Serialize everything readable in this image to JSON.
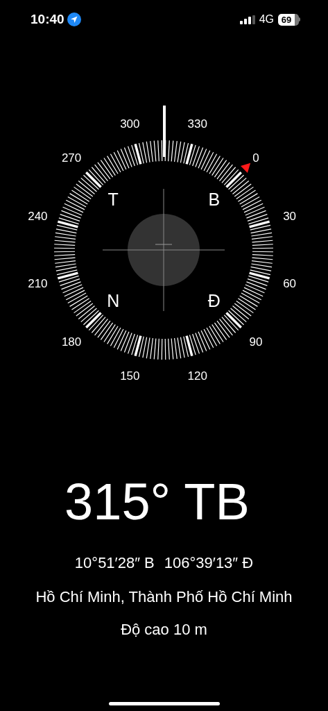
{
  "status_bar": {
    "time": "10:40",
    "network": "4G",
    "battery": "69"
  },
  "compass": {
    "degree_labels": [
      "0",
      "30",
      "60",
      "90",
      "120",
      "150",
      "180",
      "210",
      "240",
      "270",
      "300",
      "330"
    ],
    "cardinal_letters": [
      "T",
      "B",
      "N",
      "Đ"
    ]
  },
  "heading": "315° TB",
  "coordinates": [
    "10°51′28″ B",
    "106°39′13″ Đ"
  ],
  "place": "Hồ Chí Minh, Thành Phố Hồ Chí Minh",
  "altitude": "Độ cao 10 m"
}
